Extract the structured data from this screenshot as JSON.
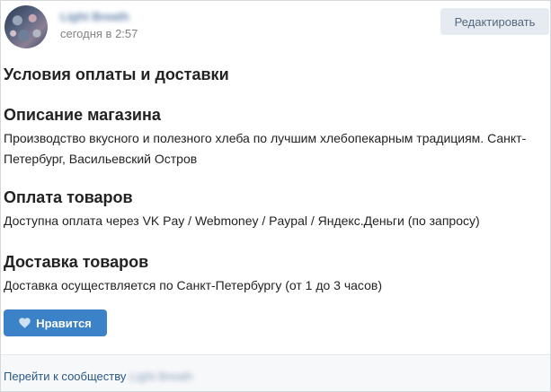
{
  "post": {
    "author_name": "Light Breath",
    "time": "сегодня в 2:57",
    "edit_label": "Редактировать"
  },
  "article": {
    "title": "Условия оплаты и доставки",
    "sections": [
      {
        "heading": "Описание магазина",
        "text": "Производство вкусного и полезного хлеба по лучшим хлебопекарным традициям. Санкт-Петербург, Васильевский Остров"
      },
      {
        "heading": "Оплата товаров",
        "text": "Доступна оплата через VK Pay / Webmoney / Paypal / Яндекс.Деньги (по запросу)"
      },
      {
        "heading": "Доставка товаров",
        "text": "Доставка осуществляется по Санкт-Петербургу (от 1 до 3 часов)"
      }
    ]
  },
  "like_button": {
    "label": "Нравится",
    "icon": "heart-icon"
  },
  "footer": {
    "link_text": "Перейти к сообществу",
    "community_name": "Light Breath"
  },
  "colors": {
    "accent": "#3c82c8",
    "link": "#2a5885",
    "secondary_button_bg": "#e5ebf1",
    "muted_text": "#828282"
  }
}
